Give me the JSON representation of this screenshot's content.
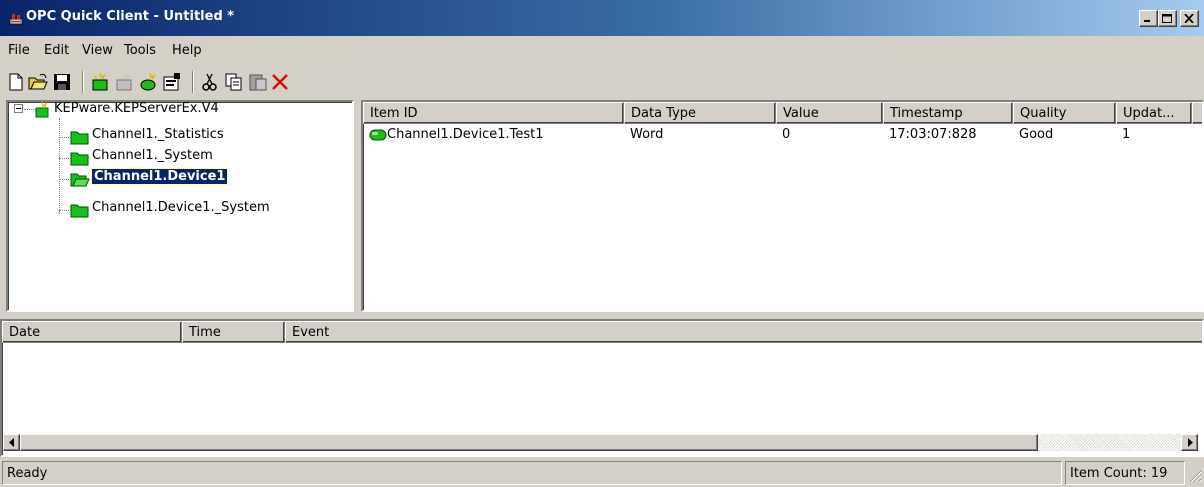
{
  "window": {
    "title": "OPC Quick Client - Untitled *",
    "controls": [
      "minimize",
      "maximize",
      "close"
    ]
  },
  "menu": {
    "items": [
      "File",
      "Edit",
      "View",
      "Tools",
      "Help"
    ]
  },
  "toolbar": {
    "icons": [
      "new-icon",
      "open-icon",
      "save-icon",
      "new-server-icon",
      "new-group-icon",
      "new-item-icon",
      "properties-icon",
      "cut-icon",
      "copy-icon",
      "paste-icon",
      "delete-icon"
    ]
  },
  "tree": {
    "root": "KEPware.KEPServerEx.V4",
    "children": [
      {
        "label": "Channel1._Statistics",
        "selected": false
      },
      {
        "label": "Channel1._System",
        "selected": false
      },
      {
        "label": "Channel1.Device1",
        "selected": true
      },
      {
        "label": "Channel1.Device1._System",
        "selected": false
      }
    ]
  },
  "items_list": {
    "columns": [
      "Item ID",
      "Data Type",
      "Value",
      "Timestamp",
      "Quality",
      "Updat..."
    ],
    "rows": [
      {
        "item_id": "Channel1.Device1.Test1",
        "data_type": "Word",
        "value": "0",
        "timestamp": "17:03:07:828",
        "quality": "Good",
        "update_count": "1"
      }
    ]
  },
  "event_log": {
    "columns": [
      "Date",
      "Time",
      "Event"
    ],
    "rows": []
  },
  "status": {
    "text": "Ready",
    "item_count": "Item Count: 19"
  },
  "colors": {
    "title_gradient_start": "#0a246a",
    "title_gradient_end": "#a6caf0",
    "selection": "#0a246a",
    "face": "#d4d0c8",
    "folder": "#1bbf1b"
  }
}
